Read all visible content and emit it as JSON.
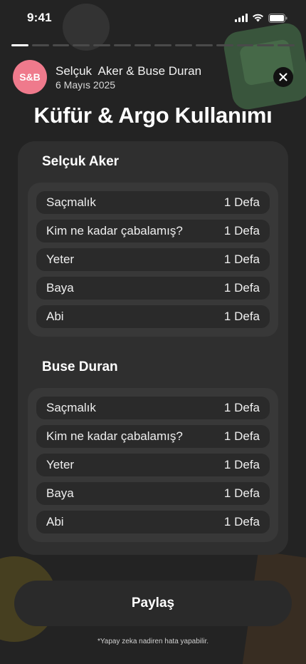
{
  "status_bar": {
    "time": "9:41"
  },
  "progress": {
    "segments": 14,
    "active_index": 0
  },
  "header": {
    "avatar_initials": "S&B",
    "title": "Selçuk  Aker & Buse Duran",
    "date": "6 Mayıs 2025",
    "close_icon": "close-icon"
  },
  "page_title": "Küfür & Argo Kullanımı",
  "sections": [
    {
      "name": "Selçuk Aker",
      "items": [
        {
          "word": "Saçmalık",
          "count": "1 Defa"
        },
        {
          "word": "Kim ne kadar çabalamış?",
          "count": "1 Defa"
        },
        {
          "word": "Yeter",
          "count": "1 Defa"
        },
        {
          "word": "Baya",
          "count": "1 Defa"
        },
        {
          "word": "Abi",
          "count": "1 Defa"
        }
      ]
    },
    {
      "name": "Buse Duran",
      "items": [
        {
          "word": "Saçmalık",
          "count": "1 Defa"
        },
        {
          "word": "Kim ne kadar çabalamış?",
          "count": "1 Defa"
        },
        {
          "word": "Yeter",
          "count": "1 Defa"
        },
        {
          "word": "Baya",
          "count": "1 Defa"
        },
        {
          "word": "Abi",
          "count": "1 Defa"
        }
      ]
    }
  ],
  "share_label": "Paylaş",
  "disclaimer": "*Yapay zeka nadiren hata yapabilir.",
  "colors": {
    "avatar": "#ef7a8c",
    "background": "#232323",
    "card": "#2f2f2f"
  }
}
